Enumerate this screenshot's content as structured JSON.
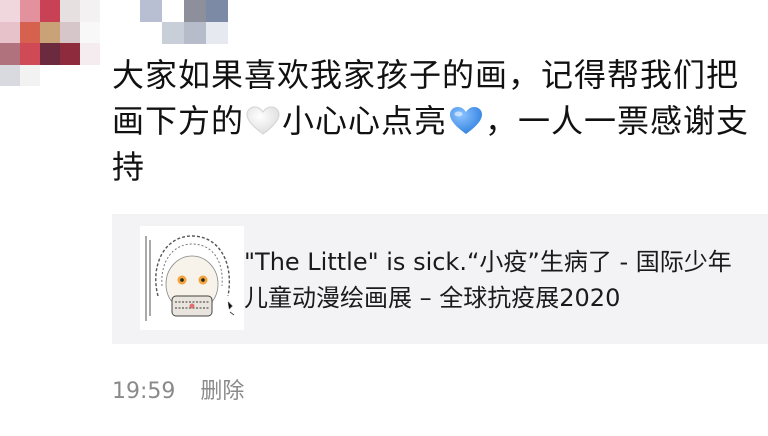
{
  "post": {
    "message_part1": "大家如果喜欢我家孩子的画，记得帮我们把画下方的",
    "message_part2": "小心心点亮",
    "message_part3": "，一人一票感谢支持",
    "heart_white_icon": "white-heart",
    "heart_blue_icon": "blue-heart",
    "heart_blue_color": "#3a8ee6"
  },
  "link_card": {
    "title": "\"The Little\" is sick.“小疫”生病了 - 国际少年儿童动漫绘画展 – 全球抗疫展2020",
    "thumbnail_icon": "drawing-thumbnail"
  },
  "meta": {
    "time": "19:59",
    "delete_label": "删除"
  }
}
